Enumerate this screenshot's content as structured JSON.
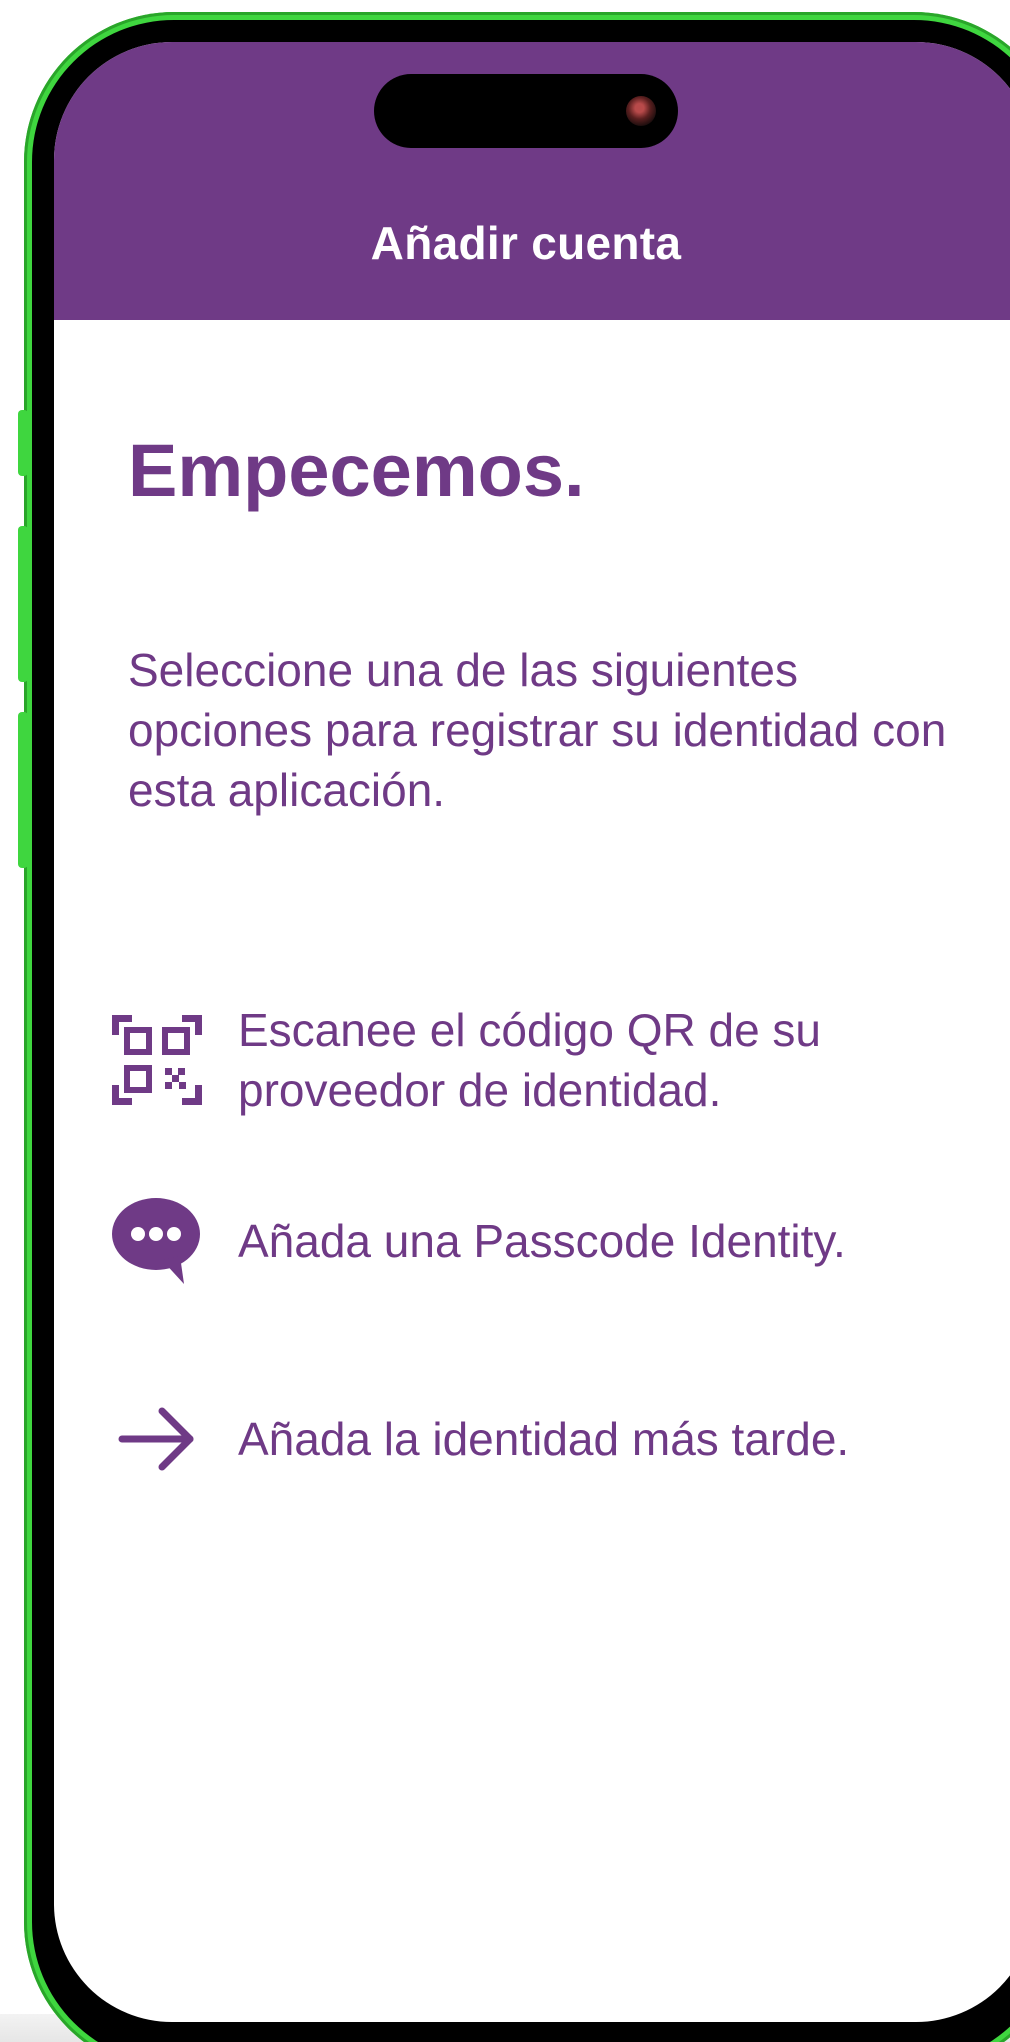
{
  "header": {
    "title": "Añadir cuenta"
  },
  "main": {
    "headline": "Empecemos.",
    "intro": "Seleccione una de las siguientes opciones para registrar su identidad con esta aplicación.",
    "options": [
      {
        "label": "Escanee el código QR de su proveedor de identidad.",
        "icon": "qr-code-icon"
      },
      {
        "label": "Añada una Passcode Identity.",
        "icon": "chat-bubble-icon"
      },
      {
        "label": "Añada la identidad más tarde.",
        "icon": "arrow-right-icon"
      }
    ]
  },
  "colors": {
    "accent": "#6f3a86",
    "header_text": "#ffffff",
    "background": "#ffffff",
    "device_frame": "#3fd63f"
  }
}
